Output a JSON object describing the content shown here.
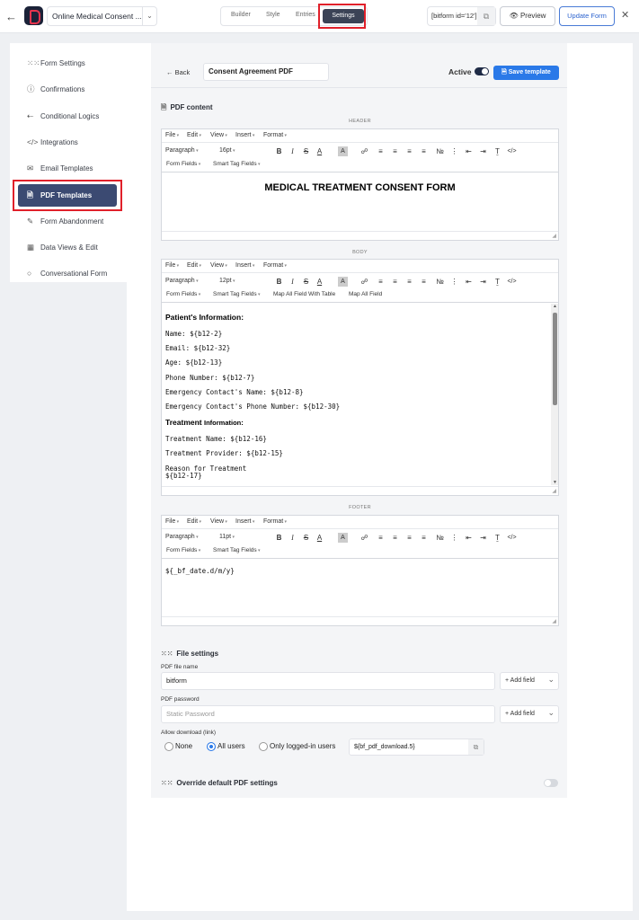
{
  "topbar": {
    "back_icon": "arrow-left-icon",
    "form_name": "Online Medical Consent ...",
    "tabs": [
      "Builder",
      "Style",
      "Entries",
      "Settings"
    ],
    "active_tab": "Settings",
    "shortcode": "[bitform id='12']",
    "preview_label": "Preview",
    "update_label": "Update Form",
    "close_glyph": "✕"
  },
  "sidebar": {
    "items": [
      {
        "label": "Form Settings",
        "icon": "sliders-icon"
      },
      {
        "label": "Confirmations",
        "icon": "info-circle-icon"
      },
      {
        "label": "Conditional Logics",
        "icon": "branch-icon"
      },
      {
        "label": "Integrations",
        "icon": "code-icon"
      },
      {
        "label": "Email Templates",
        "icon": "envelope-icon"
      },
      {
        "label": "PDF Templates",
        "icon": "file-icon"
      },
      {
        "label": "Form Abandonment",
        "icon": "form-edit-icon"
      },
      {
        "label": "Data Views & Edit",
        "icon": "table-icon"
      },
      {
        "label": "Conversational Form",
        "icon": "chat-icon"
      }
    ],
    "active": "PDF Templates"
  },
  "template": {
    "back_label": "Back",
    "name": "Consent Agreement PDF",
    "active_label": "Active",
    "active": true,
    "save_label": "Save template"
  },
  "pdf_content": {
    "heading": "PDF content",
    "menus": [
      "File",
      "Edit",
      "View",
      "Insert",
      "Format"
    ],
    "header": {
      "label": "HEADER",
      "block": "Paragraph",
      "size": "16pt",
      "bar3": [
        "Form Fields",
        "Smart Tag Fields"
      ],
      "content": "MEDICAL TREATMENT CONSENT FORM"
    },
    "body": {
      "label": "BODY",
      "block": "Paragraph",
      "size": "12pt",
      "bar3": [
        "Form Fields",
        "Smart Tag Fields",
        "Map All Field With Table",
        "Map All Field"
      ],
      "heading1": "Patient's Information:",
      "lines1": [
        "Name: ${b12-2}",
        "Email: ${b12-32}",
        "Age: ${b12-13}",
        "Phone Number: ${b12-7}",
        "Emergency Contact's Name: ${b12-8}",
        "Emergency Contact's Phone Number: ${b12-30}"
      ],
      "heading2a": "Treatment",
      "heading2b": "Information:",
      "lines2": [
        "Treatment Name: ${b12-16}",
        "Treatment Provider: ${b12-15}"
      ],
      "reason_label": "Reason for Treatment",
      "reason_value": "${b12-17}"
    },
    "footer": {
      "label": "FOOTER",
      "block": "Paragraph",
      "size": "11pt",
      "bar3": [
        "Form Fields",
        "Smart Tag Fields"
      ],
      "content": "${_bf_date.d/m/y}"
    }
  },
  "file_settings": {
    "heading": "File settings",
    "file_name_label": "PDF file name",
    "file_name_value": "bitform",
    "password_label": "PDF password",
    "password_placeholder": "Static Password",
    "add_field_label": "+ Add field",
    "download_label": "Allow download (link)",
    "download_options": [
      "None",
      "All users",
      "Only logged-in users"
    ],
    "download_selected": "All users",
    "download_link": "${bf_pdf_download.5}"
  },
  "override": {
    "label": "Override default PDF settings",
    "enabled": false
  }
}
